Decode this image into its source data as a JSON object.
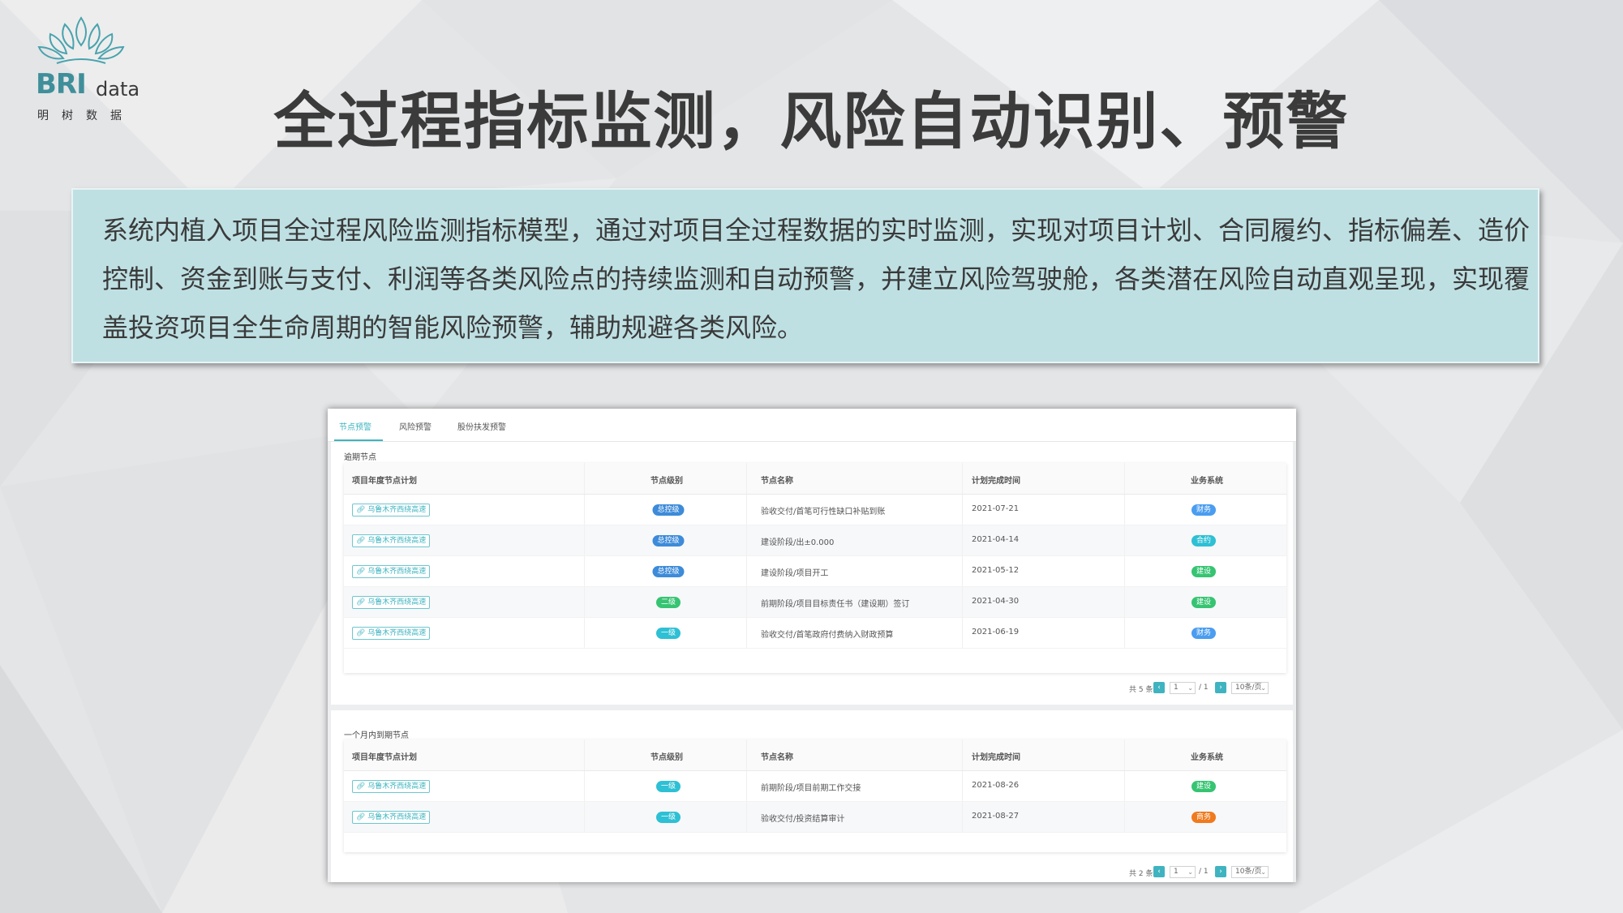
{
  "logo": {
    "brand_main": "BRI",
    "brand_sub": "data",
    "brand_cn": "明树数据"
  },
  "title": "全过程指标监测，风险自动识别、预警",
  "description": "系统内植入项目全过程风险监测指标模型，通过对项目全过程数据的实时监测，实现对项目计划、合同履约、指标偏差、造价控制、资金到账与支付、利润等各类风险点的持续监测和自动预警，并建立风险驾驶舱，各类潜在风险自动直观呈现，实现覆盖投资项目全生命周期的智能风险预警，辅助规避各类风险。",
  "colors": {
    "accent": "#3fb4c0",
    "level_total": "#3d8bd9",
    "level_second": "#36c472",
    "level_first": "#2ec0d4",
    "sys_finance": "#4a9df0",
    "sys_contract": "#2ec0d4",
    "sys_build": "#36c472",
    "sys_business": "#f07a1e"
  },
  "screenshot": {
    "tabs": [
      {
        "label": "节点预警",
        "active": true
      },
      {
        "label": "风险预警",
        "active": false
      },
      {
        "label": "股份扶发预警",
        "active": false
      }
    ],
    "overdue": {
      "title": "逾期节点",
      "headers": [
        "项目年度节点计划",
        "节点级别",
        "节点名称",
        "计划完成时间",
        "业务系统"
      ],
      "rows": [
        {
          "project": "乌鲁木齐西绕高速",
          "level": "总控级",
          "level_color": "#3d8bd9",
          "node": "验收交付/首笔可行性缺口补贴到账",
          "date": "2021-07-21",
          "system": "财务",
          "system_color": "#4a9df0"
        },
        {
          "project": "乌鲁木齐西绕高速",
          "level": "总控级",
          "level_color": "#3d8bd9",
          "node": "建设阶段/出±0.000",
          "date": "2021-04-14",
          "system": "合约",
          "system_color": "#2ec0d4"
        },
        {
          "project": "乌鲁木齐西绕高速",
          "level": "总控级",
          "level_color": "#3d8bd9",
          "node": "建设阶段/项目开工",
          "date": "2021-05-12",
          "system": "建设",
          "system_color": "#36c472"
        },
        {
          "project": "乌鲁木齐西绕高速",
          "level": "二级",
          "level_color": "#36c472",
          "node": "前期阶段/项目目标责任书（建设期）签订",
          "date": "2021-04-30",
          "system": "建设",
          "system_color": "#36c472"
        },
        {
          "project": "乌鲁木齐西绕高速",
          "level": "一级",
          "level_color": "#2ec0d4",
          "node": "验收交付/首笔政府付费纳入财政预算",
          "date": "2021-06-19",
          "system": "财务",
          "system_color": "#4a9df0"
        }
      ],
      "pager": {
        "total": "共 5 条",
        "page": "1",
        "of": "/ 1",
        "size": "10条/页"
      }
    },
    "month": {
      "title": "一个月内到期节点",
      "headers": [
        "项目年度节点计划",
        "节点级别",
        "节点名称",
        "计划完成时间",
        "业务系统"
      ],
      "rows": [
        {
          "project": "乌鲁木齐西绕高速",
          "level": "一级",
          "level_color": "#2ec0d4",
          "node": "前期阶段/项目前期工作交接",
          "date": "2021-08-26",
          "system": "建设",
          "system_color": "#36c472"
        },
        {
          "project": "乌鲁木齐西绕高速",
          "level": "一级",
          "level_color": "#2ec0d4",
          "node": "验收交付/投资结算审计",
          "date": "2021-08-27",
          "system": "商务",
          "system_color": "#f07a1e"
        }
      ],
      "pager": {
        "total": "共 2 条",
        "page": "1",
        "of": "/ 1",
        "size": "10条/页"
      }
    }
  }
}
